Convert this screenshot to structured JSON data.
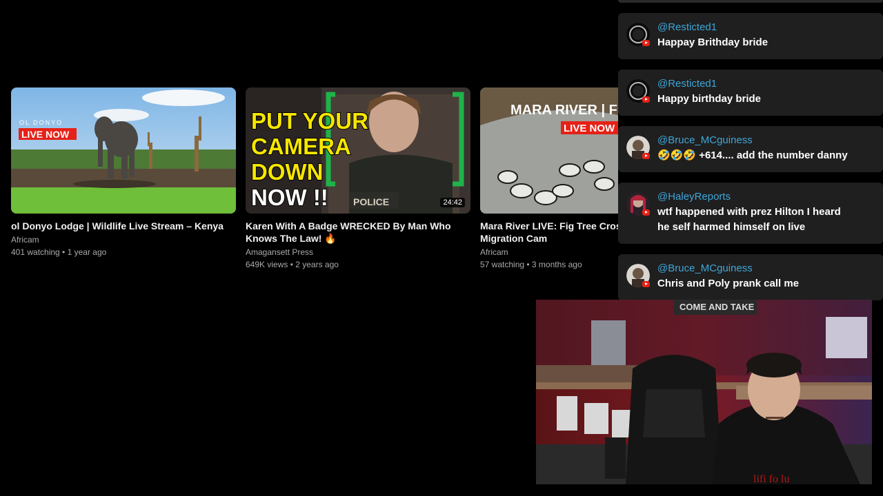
{
  "videos": [
    {
      "title": "ol Donyo Lodge | Wildlife Live Stream – Kenya",
      "channel": "Africam",
      "stats": "401 watching • 1 year ago",
      "thumb_brand": "OL DONYO",
      "thumb_badge": "LIVE NOW"
    },
    {
      "title": "Karen With A Badge WRECKED By Man Who Knows The Law! 🔥",
      "channel": "Amagansett Press",
      "stats": "649K views • 2 years ago",
      "thumb_lines": [
        "PUT YOUR",
        "CAMERA",
        "DOWN",
        "NOW !!"
      ],
      "thumb_patch": "POLICE",
      "duration": "24:42"
    },
    {
      "title": "Mara River LIVE: Fig Tree Cros",
      "title_line2": "Migration Cam",
      "channel": "Africam",
      "stats": "57 watching • 3 months ago",
      "thumb_brand": "MARA RIVER | F",
      "thumb_badge": "LIVE NOW"
    }
  ],
  "chat": {
    "messages": [
      {
        "user": "@Resticted1",
        "text": "Happay Brithday bride",
        "avatar": "dark-orb"
      },
      {
        "user": "@Resticted1",
        "text": "Happy birthday bride",
        "avatar": "dark-orb"
      },
      {
        "user": "@Bruce_MCguiness",
        "text": "🤣🤣🤣 +614.... add the number danny",
        "avatar": "portrait"
      },
      {
        "user": "@HaleyReports",
        "text": "wtf happened with prez Hilton I heard",
        "text_line2": "he self harmed himself on live",
        "avatar": "portrait-red"
      },
      {
        "user": "@Bruce_MCguiness",
        "text": "Chris and Poly prank call me",
        "avatar": "portrait"
      }
    ]
  },
  "webcam": {
    "wall_banner": "COME AND TAKE"
  },
  "colors": {
    "username": "#3ea6d9",
    "chat_bg": "#1f1f1f",
    "live_red": "#e62117",
    "thumb_yellow": "#f5e600",
    "thumb_green": "#1fb34a"
  }
}
